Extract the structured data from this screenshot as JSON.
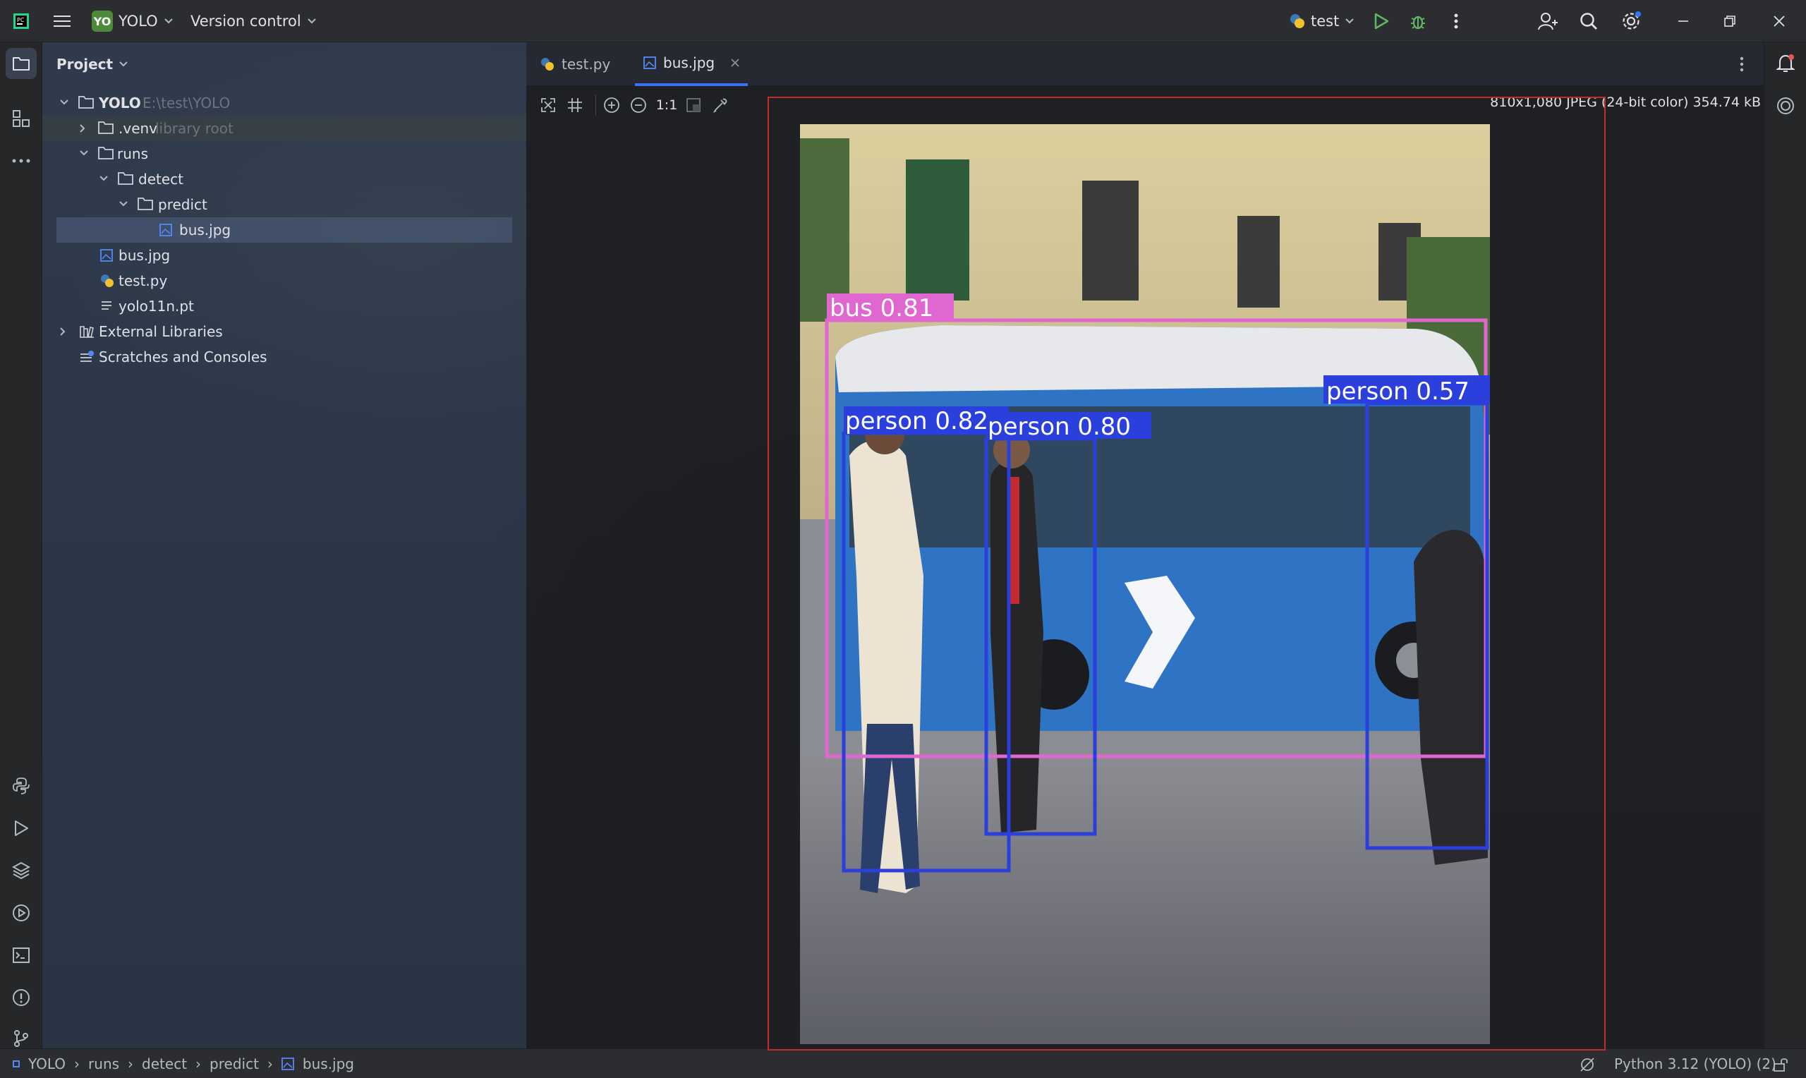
{
  "titlebar": {
    "project_badge": "YO",
    "project_name": "YOLO",
    "vcs_label": "Version control",
    "run_config": "test"
  },
  "project_pane": {
    "title": "Project",
    "root_name": "YOLO",
    "root_path": "E:\\test\\YOLO",
    "items": [
      {
        "label": "YOLO",
        "hint": "E:\\test\\YOLO"
      },
      {
        "label": ".venv",
        "hint": "library root"
      },
      {
        "label": "runs"
      },
      {
        "label": "detect"
      },
      {
        "label": "predict"
      },
      {
        "label": "bus.jpg"
      },
      {
        "label": "bus.jpg"
      },
      {
        "label": "test.py"
      },
      {
        "label": "yolo11n.pt"
      },
      {
        "label": "External Libraries"
      },
      {
        "label": "Scratches and Consoles"
      }
    ]
  },
  "tabs": [
    {
      "label": "test.py",
      "active": false
    },
    {
      "label": "bus.jpg",
      "active": true
    }
  ],
  "image_toolbar": {
    "actual_size_label": "1:1"
  },
  "image_info": "810x1,080 JPEG (24-bit color) 354.74 kB",
  "detections": [
    {
      "label": "bus 0.81",
      "color": "#e066d0"
    },
    {
      "label": "person 0.82",
      "color": "#2a3fdc"
    },
    {
      "label": "person 0.80",
      "color": "#2a3fdc"
    },
    {
      "label": "person 0.57",
      "color": "#2a3fdc"
    }
  ],
  "statusbar": {
    "breadcrumbs": [
      "YOLO",
      "runs",
      "detect",
      "predict",
      "bus.jpg"
    ],
    "interpreter": "Python 3.12 (YOLO) (2)"
  },
  "colors": {
    "accent": "#3574f0",
    "run_green": "#5fb865",
    "selection": "#4b5c78",
    "image_border": "#c42b2b"
  }
}
